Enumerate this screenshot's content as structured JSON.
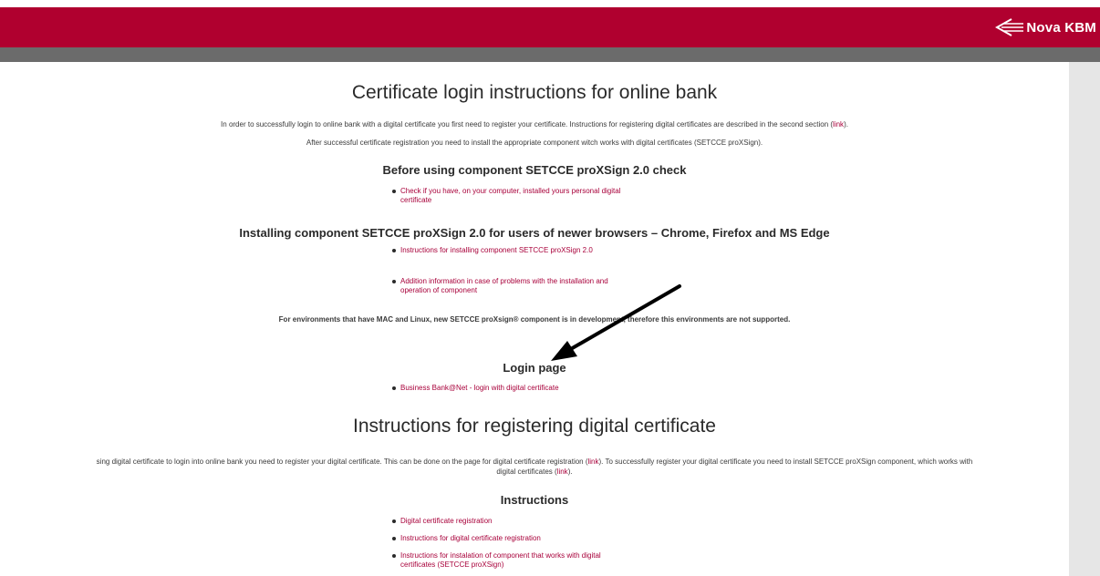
{
  "brand": {
    "name": "Nova KBM",
    "color": "#b0002f"
  },
  "main": {
    "title": "Certificate login instructions for online bank",
    "intro_line1_pre": "In order to successfully login to online bank with a digital certificate you first need to register your certificate. Instructions for registering digital certificates are described in the second section (",
    "intro_line1_link": "link",
    "intro_line1_post": ").",
    "intro_line2": "After successful certificate registration you need to install the appropriate component witch works with digital certificates (SETCCE proXSign).",
    "before_heading": "Before using component SETCCE proXSign 2.0 check",
    "before_items": [
      "Check if you have, on your computer, installed yours personal digital certificate"
    ],
    "install_heading": "Installing component SETCCE proXSign 2.0 for users of newer browsers – Chrome, Firefox and MS Edge",
    "install_items": [
      "Instructions for installing component SETCCE proXSign 2.0",
      "Addition information in case of problems with the installation and operation of component"
    ],
    "env_note": "For environments that have MAC and Linux, new SETCCE proXsign® component is in development, therefore this environments are not supported.",
    "login_heading": "Login page",
    "login_items": [
      "Business Bank@Net - login with digital certificate"
    ],
    "reg_title": "Instructions for registering digital certificate",
    "reg_para_pre": "sing digital certificate to login into online bank you need to register your digital certificate. This can be done on the page for digital certificate registration (",
    "reg_para_link1": "link",
    "reg_para_mid": "). To successfully register your digital certificate you need to install SETCCE proXSign component, which works with",
    "reg_para_line2_pre": "digital certificates (",
    "reg_para_link2": "link",
    "reg_para_line2_post": ").",
    "instructions_heading": "Instructions",
    "instructions_items": [
      "Digital certificate registration",
      "Instructions for digital certificate registration",
      "Instructions for instalation of component that works with digital certificates (SETCCE proXSign)"
    ]
  }
}
